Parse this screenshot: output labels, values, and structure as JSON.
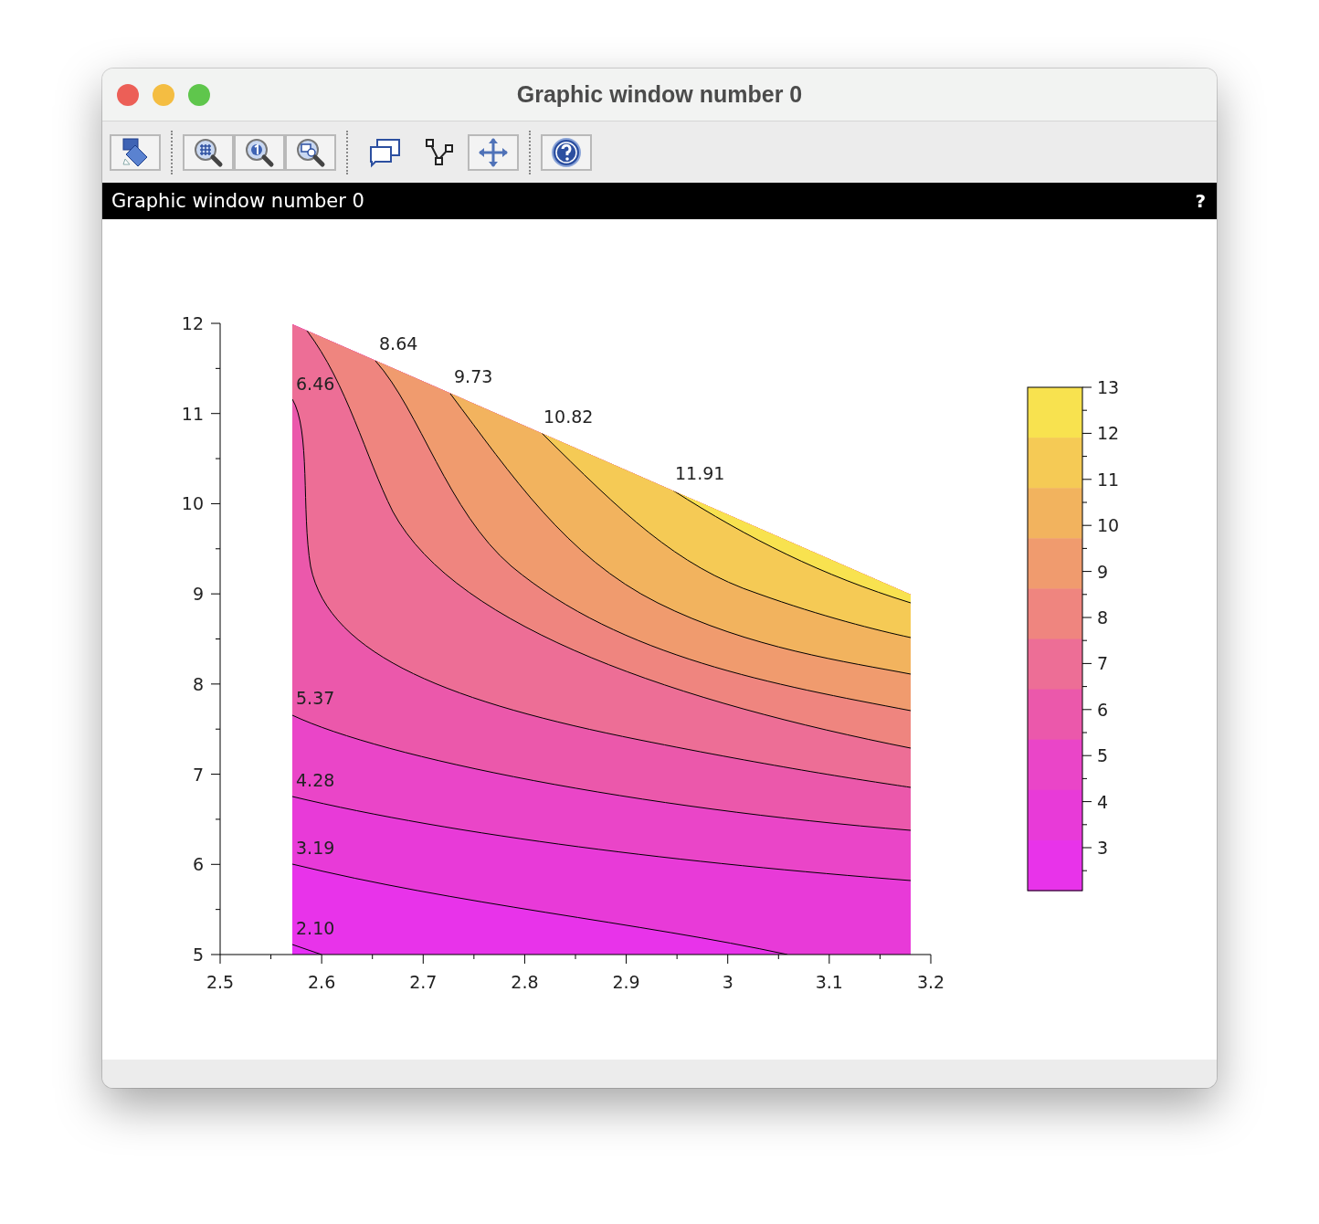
{
  "window": {
    "title": "Graphic window number 0"
  },
  "panel": {
    "title": "Graphic window number 0",
    "help_glyph": "?"
  },
  "plot": {
    "y_tick_labels": [
      "12",
      "11",
      "10",
      "9",
      "8",
      "7",
      "6",
      "5"
    ],
    "x_tick_labels": [
      "2.5",
      "2.6",
      "2.7",
      "2.8",
      "2.9",
      "3",
      "3.1",
      "3.2"
    ],
    "contour_labels": [
      "8.64",
      "9.73",
      "6.46",
      "10.82",
      "11.91",
      "5.37",
      "4.28",
      "3.19",
      "2.10"
    ],
    "colorbar_tick_labels": [
      "13",
      "12",
      "11",
      "10",
      "9",
      "8",
      "7",
      "6",
      "5",
      "4",
      "3"
    ]
  }
}
